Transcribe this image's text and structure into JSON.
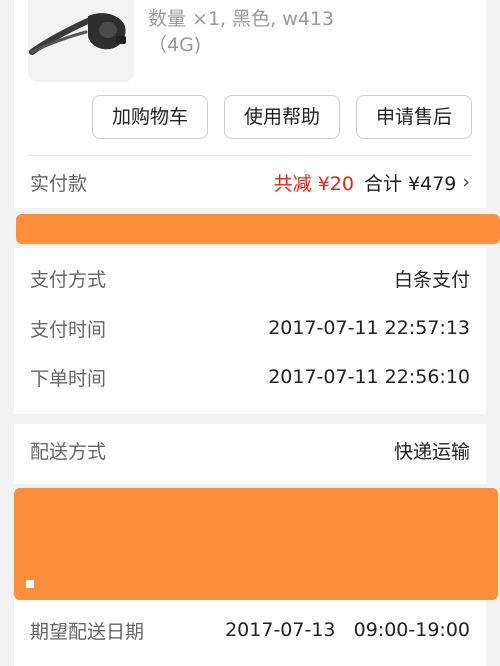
{
  "product": {
    "spec_line1": "数量 ×1, 黑色, w413",
    "spec_line2": "（4G)"
  },
  "actions": {
    "add_to_cart": "加购物车",
    "help": "使用帮助",
    "after_sales": "申请售后"
  },
  "payment_summary": {
    "label": "实付款",
    "discount": "共减 ¥20",
    "total": "合计 ¥479"
  },
  "payment": {
    "method_label": "支付方式",
    "method_value": "白条支付",
    "pay_time_label": "支付时间",
    "pay_time_value": "2017-07-11 22:57:13",
    "order_time_label": "下单时间",
    "order_time_value": "2017-07-11 22:56:10"
  },
  "delivery": {
    "method_label": "配送方式",
    "method_value": "快递运输",
    "expected_label": "期望配送日期",
    "expected_value": "2017-07-13   09:00-19:00"
  },
  "colors": {
    "redaction": "#fd8f3c",
    "discount_red": "#e1251b"
  }
}
